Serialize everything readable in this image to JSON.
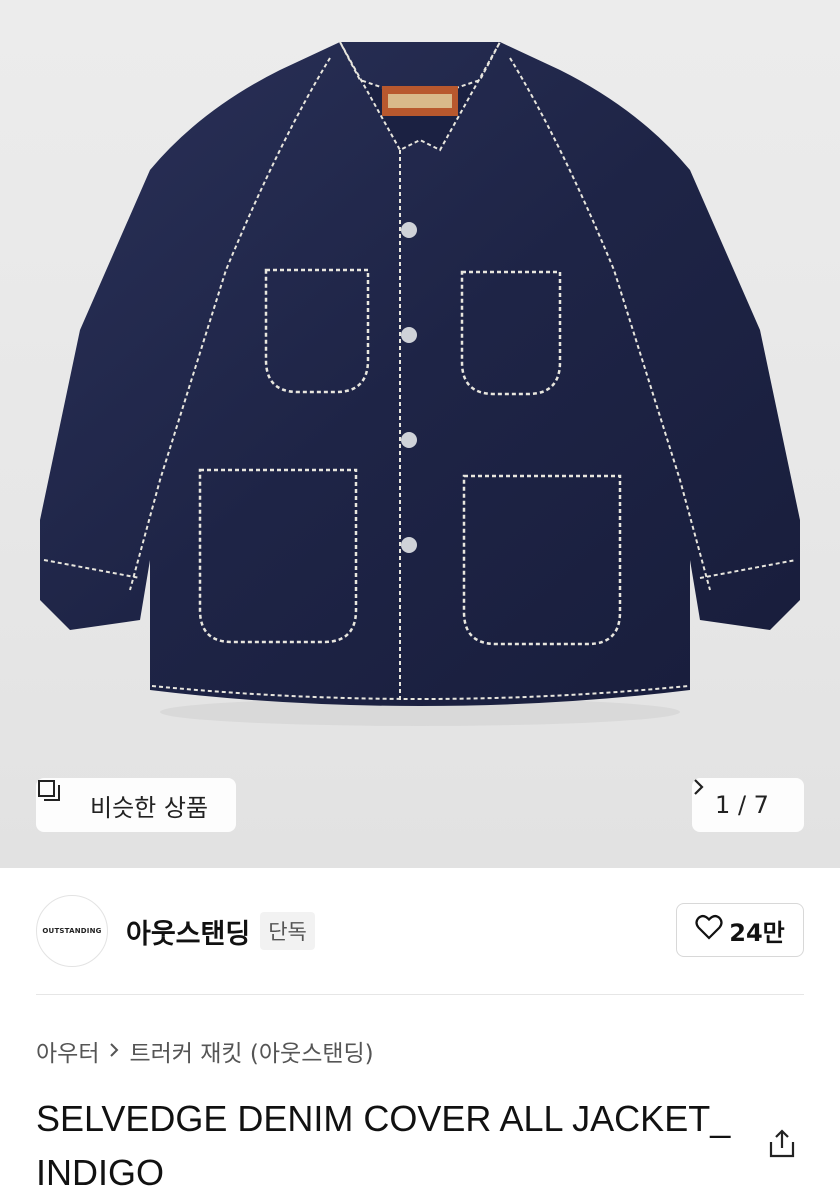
{
  "hero": {
    "similar_button_label": "비슷한 상품",
    "similar_icon": "similar-items-icon",
    "pager_text": "1 / 7",
    "pager_icon": "chevron-right-icon",
    "product_image_label": "OUTSTANDING"
  },
  "brand": {
    "logo_text": "OUTSTANDING",
    "name": "아웃스탠딩",
    "badge": "단독",
    "like_icon": "heart-icon",
    "like_count": "24만"
  },
  "breadcrumb": {
    "category": "아우터",
    "separator_icon": "chevron-right-icon",
    "subcategory": "트러커 재킷 (아웃스탠딩)"
  },
  "product": {
    "title": "SELVEDGE DENIM COVER ALL JACKET_INDIGO",
    "share_icon": "share-icon"
  },
  "colors": {
    "denim": "#1f2547",
    "stitch": "#e8e6de",
    "hero_bg": "#e8e8e8"
  }
}
